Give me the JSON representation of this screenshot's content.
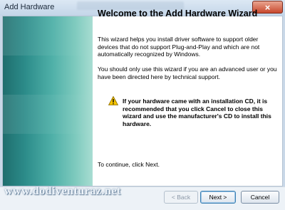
{
  "window": {
    "title": "Add Hardware",
    "close_label": "×"
  },
  "wizard": {
    "heading": "Welcome to the Add Hardware Wizard",
    "paragraph1": "This wizard helps you install driver software to support older devices that do not support Plug-and-Play and which are not automatically recognized by Windows.",
    "paragraph2": "You should only use this wizard if you are an advanced user or you have been directed here by technical support.",
    "warning": "If your hardware came with an installation CD, it is recommended that you click Cancel to close this wizard and use the manufacturer's CD to install this hardware.",
    "continue_text": "To continue, click Next."
  },
  "buttons": {
    "back": "< Back",
    "next": "Next >",
    "cancel": "Cancel"
  },
  "watermark": "www.dodiventuraz.net",
  "icons": {
    "warning": "warning-triangle-icon",
    "close": "close-icon"
  },
  "colors": {
    "accent": "#3c7fb1",
    "sidebar": "#2c8c8a",
    "close": "#c8482d"
  }
}
